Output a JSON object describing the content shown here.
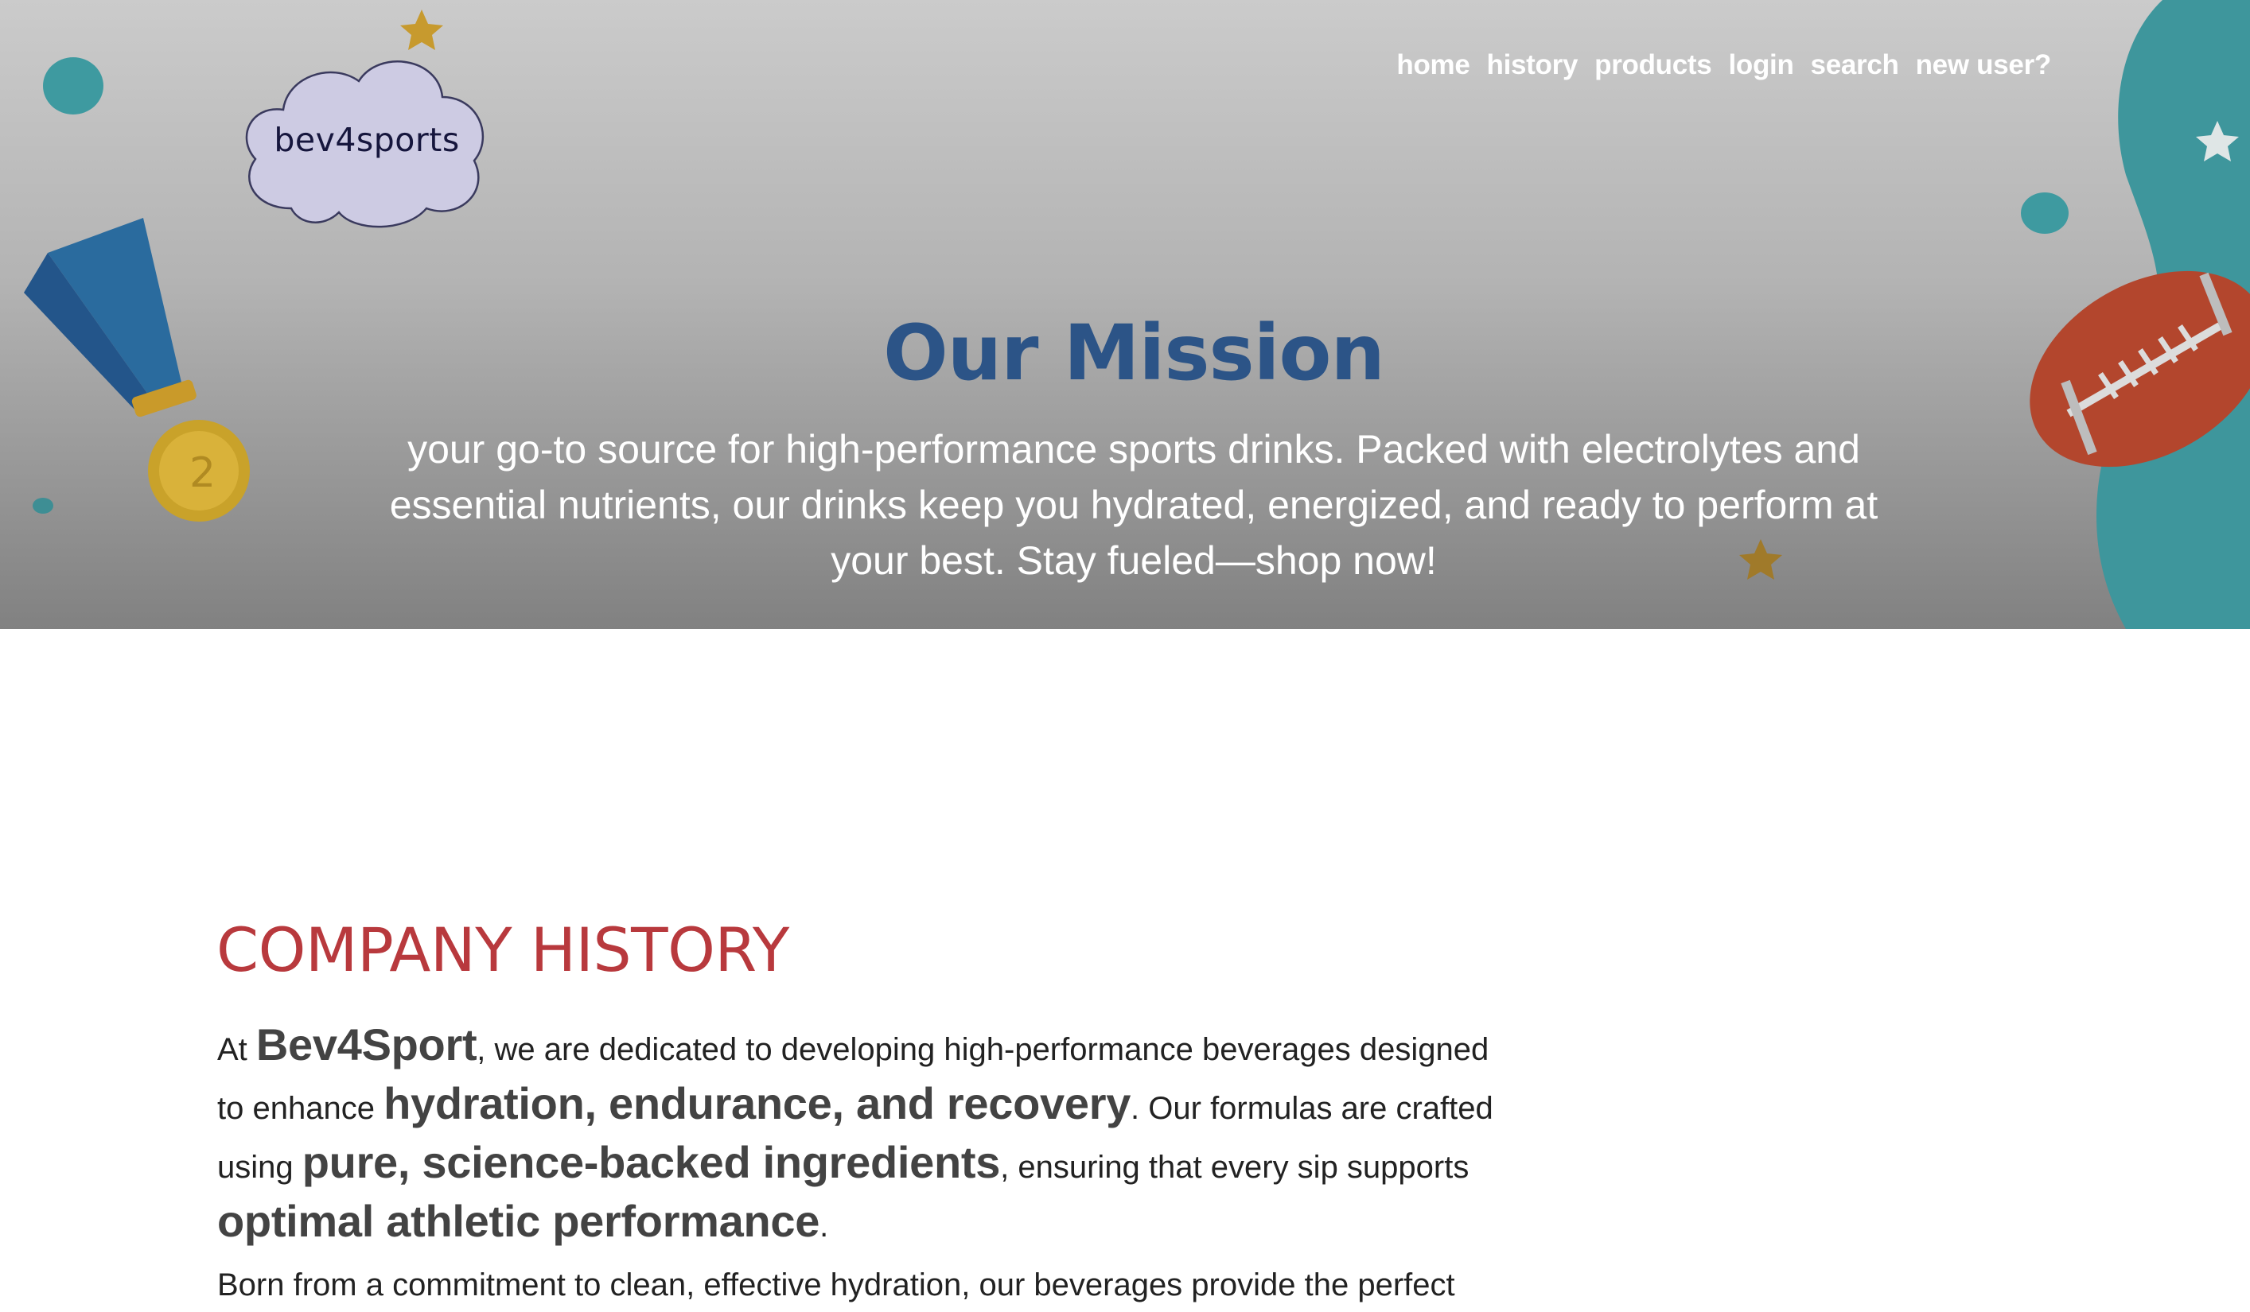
{
  "brand": {
    "logo_text": "bev4sports"
  },
  "nav": {
    "items": [
      "home",
      "history",
      "products",
      "login",
      "search",
      "new user?"
    ]
  },
  "hero": {
    "title": "Our Mission",
    "text": "your go-to source for high-performance sports drinks. Packed with electrolytes and essential nutrients, our drinks keep you hydrated, energized, and ready to perform at your best. Stay fueled—shop now!"
  },
  "history": {
    "title": "COMPANY HISTORY",
    "p1": {
      "t1": "At ",
      "b1": "Bev4Sport",
      "t2": ", we are dedicated to developing high-performance beverages designed to enhance ",
      "b2": "hydration, endurance, and recovery",
      "t3": ". Our formulas are crafted using ",
      "b3": "pure, science-backed ingredients",
      "t4": ", ensuring that every sip supports ",
      "b4": "optimal athletic performance",
      "t5": "."
    },
    "p2": "Born from a commitment to clean, effective hydration, our beverages provide the perfect"
  },
  "colors": {
    "title_blue": "#2c5487",
    "history_red": "#b8393d",
    "teal": "#3e969c",
    "gold": "#c79a2e",
    "football": "#b3462d"
  },
  "icons": [
    "star-icon",
    "medal-icon",
    "football-icon",
    "cloud-icon"
  ]
}
